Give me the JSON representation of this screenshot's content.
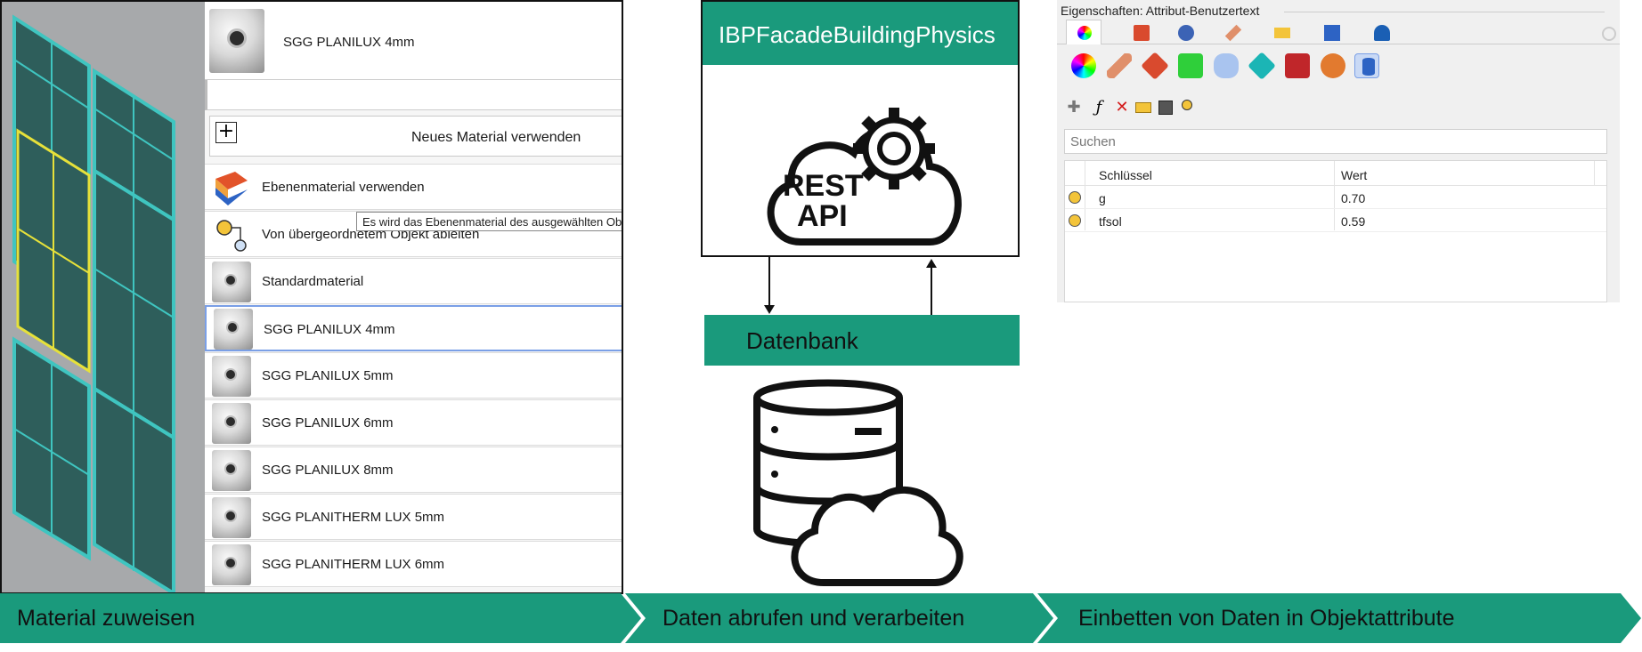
{
  "left_panel": {
    "preview_material": "SGG PLANILUX 4mm",
    "new_material_label": "Neues Material verwenden",
    "items": [
      {
        "label": "Ebenenmaterial verwenden",
        "icon": "layer-material-icon"
      },
      {
        "label": "Von übergeordnetem Objekt ableiten",
        "icon": "parent-object-icon"
      },
      {
        "label": "Standardmaterial",
        "icon": "material-sphere-icon"
      },
      {
        "label": "SGG PLANILUX 4mm",
        "icon": "material-sphere-icon",
        "selected": true
      },
      {
        "label": "SGG PLANILUX 5mm",
        "icon": "material-sphere-icon"
      },
      {
        "label": "SGG PLANILUX 6mm",
        "icon": "material-sphere-icon"
      },
      {
        "label": "SGG PLANILUX 8mm",
        "icon": "material-sphere-icon"
      },
      {
        "label": "SGG PLANITHERM LUX 5mm",
        "icon": "material-sphere-icon"
      },
      {
        "label": "SGG PLANITHERM LUX 6mm",
        "icon": "material-sphere-icon"
      }
    ],
    "tooltip": "Es wird das Ebenenmaterial des ausgewählten Objekts verwendet"
  },
  "middle": {
    "api_title": "IBPFacadeBuildingPhysics",
    "rest_line1": "REST",
    "rest_line2": "API",
    "db_label": "Datenbank"
  },
  "right_panel": {
    "title": "Eigenschaften: Attribut-Benutzertext",
    "search_placeholder": "Suchen",
    "columns": [
      "Schlüssel",
      "Wert"
    ],
    "rows": [
      {
        "key": "g",
        "value": "0.70"
      },
      {
        "key": "tfsol",
        "value": "0.59"
      }
    ]
  },
  "steps": [
    "Material zuweisen",
    "Daten abrufen und verarbeiten",
    "Einbetten von Daten in Objektattribute"
  ],
  "colors": {
    "accent": "#1a9a7c",
    "facade_glass": "#2e5e5b",
    "facade_frame": "#3fc5c0",
    "highlight": "#e6e13a",
    "selection": "#7a9fe6"
  }
}
